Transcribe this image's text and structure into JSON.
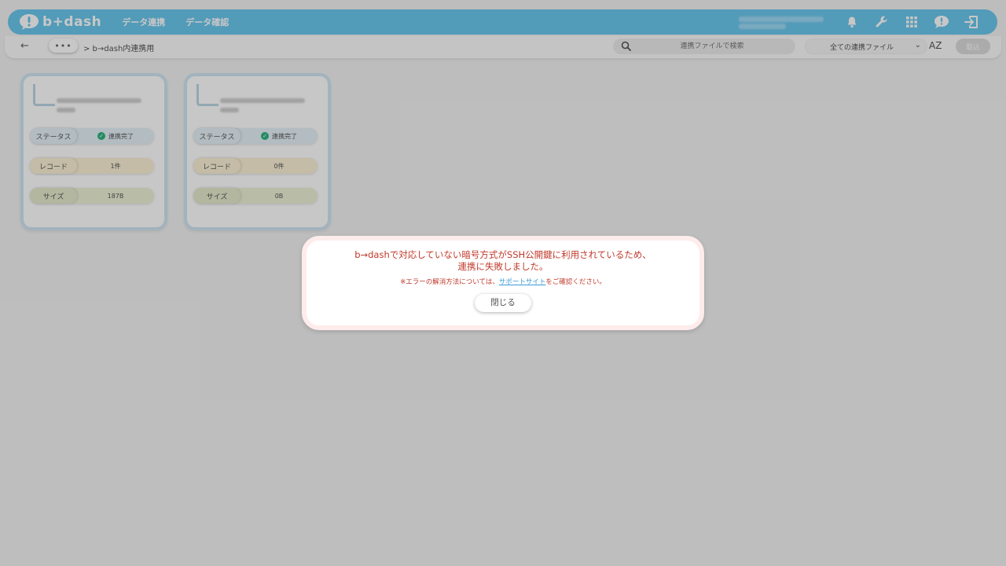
{
  "header": {
    "logo_text": "b+dash",
    "nav": [
      "データ連携",
      "データ確認"
    ],
    "icons": [
      "bell-icon",
      "wrench-icon",
      "grid-icon",
      "chat-icon",
      "logout-icon"
    ]
  },
  "toolbar": {
    "back": "←",
    "more": "•••",
    "breadcrumb": "> b→dash内連携用",
    "search_placeholder": "連携ファイルで検索",
    "filter_value": "全ての連携ファイル",
    "sort_label": "AZ",
    "cancel_label": "取込"
  },
  "cards": [
    {
      "status_label": "ステータス",
      "status_value": "連携完了",
      "record_label": "レコード",
      "record_value": "1件",
      "size_label": "サイズ",
      "size_value": "187B"
    },
    {
      "status_label": "ステータス",
      "status_value": "連携完了",
      "record_label": "レコード",
      "record_value": "0件",
      "size_label": "サイズ",
      "size_value": "0B"
    }
  ],
  "modal": {
    "message_line1": "b→dashで対応していない暗号方式がSSH公開鍵に利用されているため、",
    "message_line2": "連携に失敗しました。",
    "note_prefix": "※エラーの解消方法については、",
    "note_link": "サポートサイト",
    "note_suffix": "をご確認ください。",
    "close_label": "閉じる"
  },
  "colors": {
    "header": "#6ac7ee",
    "error": "#c0392b",
    "link": "#3b9bd8",
    "success": "#2fb37e"
  }
}
